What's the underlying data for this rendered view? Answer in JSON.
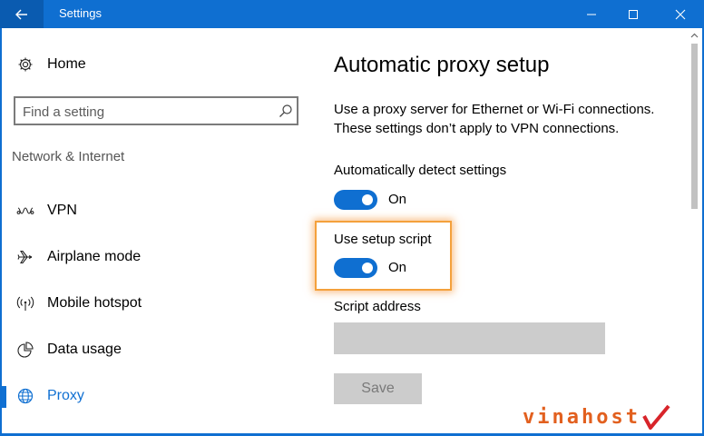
{
  "window": {
    "title": "Settings",
    "accent": "#0f6fd1"
  },
  "sidebar": {
    "home_label": "Home",
    "search_placeholder": "Find a setting",
    "section_header": "Network & Internet",
    "items": [
      {
        "label": "VPN",
        "icon": "vpn-icon"
      },
      {
        "label": "Airplane mode",
        "icon": "airplane-icon"
      },
      {
        "label": "Mobile hotspot",
        "icon": "hotspot-icon"
      },
      {
        "label": "Data usage",
        "icon": "data-usage-icon"
      },
      {
        "label": "Proxy",
        "icon": "globe-icon",
        "active": true
      }
    ]
  },
  "main": {
    "title": "Automatic proxy setup",
    "description": "Use a proxy server for Ethernet or Wi-Fi connections. These settings don’t apply to VPN connections.",
    "auto_detect": {
      "label": "Automatically detect settings",
      "state": "On"
    },
    "setup_script": {
      "label": "Use setup script",
      "state": "On"
    },
    "script_address": {
      "label": "Script address",
      "value": ""
    },
    "save_label": "Save"
  },
  "watermark": {
    "text": "vinahost",
    "color": "#e2601f"
  }
}
